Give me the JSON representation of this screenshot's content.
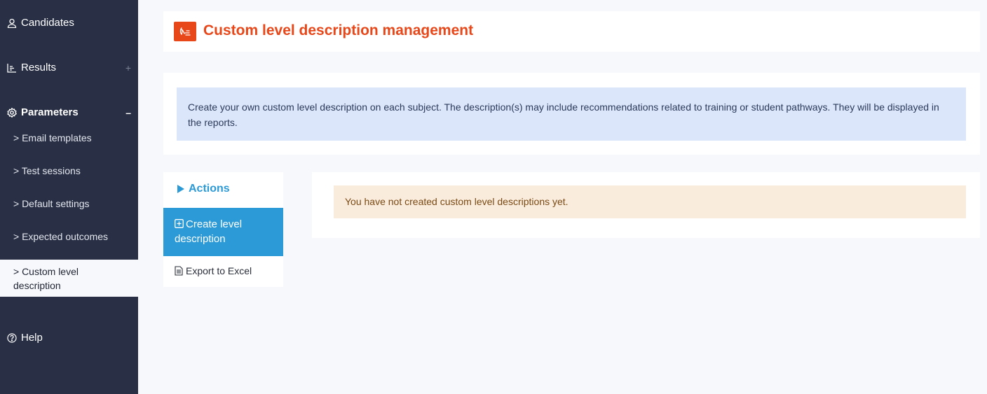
{
  "sidebar": {
    "candidates": "Candidates",
    "results": "Results",
    "results_toggle": "+",
    "parameters": "Parameters",
    "parameters_toggle": "–",
    "sub_items": [
      "> Email templates",
      "> Test sessions",
      "> Default settings",
      "> Expected outcomes",
      "> Custom level description"
    ],
    "help": "Help"
  },
  "header": {
    "title": "Custom level description management",
    "accent_color": "#e8471a"
  },
  "info": {
    "text": "Create your own custom level description on each subject. The description(s) may include recommendations related to training or student pathways. They will be displayed in the reports."
  },
  "actions": {
    "title": "Actions",
    "create_label": "Create level description",
    "export_label": "Export to Excel",
    "accent_color": "#2b9ad6"
  },
  "alert": {
    "text": "You have not created custom level descriptions yet."
  },
  "icons": {
    "candidates": "user-icon",
    "results": "bar-chart-icon",
    "parameters": "gear-icon",
    "help": "help-circle-icon",
    "header": "signature-icon",
    "actions": "triangle-right-icon",
    "create": "plus-square-icon",
    "export": "document-icon"
  }
}
